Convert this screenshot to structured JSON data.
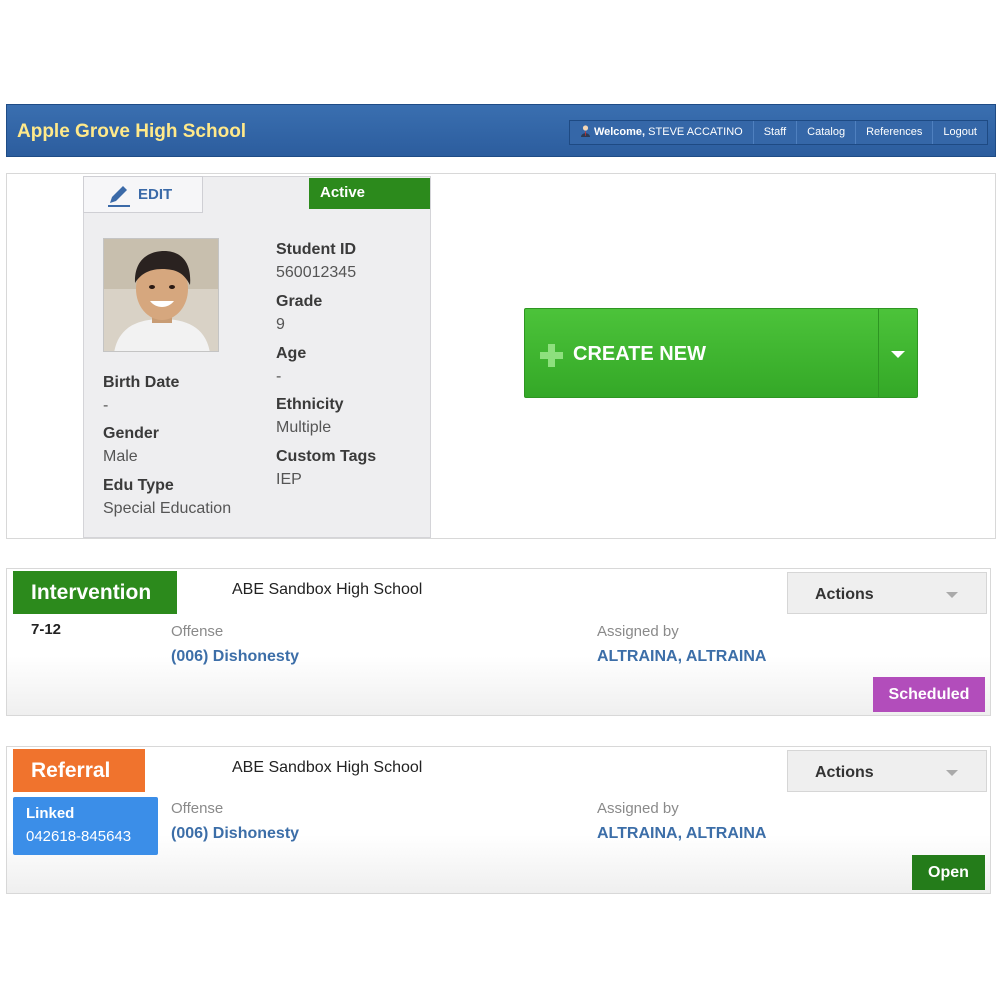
{
  "header": {
    "school_name": "Apple Grove High School",
    "welcome_prefix": "Welcome,",
    "user_name": "STEVE ACCATINO",
    "nav": [
      "Staff",
      "Catalog",
      "References",
      "Logout"
    ]
  },
  "student": {
    "edit_label": "EDIT",
    "status": "Active",
    "fields": {
      "student_id": {
        "label": "Student ID",
        "value": "560012345"
      },
      "grade": {
        "label": "Grade",
        "value": "9"
      },
      "age": {
        "label": "Age",
        "value": "-"
      },
      "ethnicity": {
        "label": "Ethnicity",
        "value": "Multiple"
      },
      "custom_tags": {
        "label": "Custom Tags",
        "value": "IEP"
      },
      "birth_date": {
        "label": "Birth Date",
        "value": "-"
      },
      "gender": {
        "label": "Gender",
        "value": "Male"
      },
      "edu_type": {
        "label": "Edu Type",
        "value": "Special Education"
      }
    }
  },
  "create_new": {
    "label": "CREATE NEW"
  },
  "records": [
    {
      "type": "Intervention",
      "school": "ABE Sandbox High School",
      "actions_label": "Actions",
      "grade_range": "7-12",
      "offense_label": "Offense",
      "offense": "(006) Dishonesty",
      "assigned_label": "Assigned by",
      "assigned_by": "ALTRAINA, ALTRAINA",
      "status": "Scheduled"
    },
    {
      "type": "Referral",
      "school": "ABE Sandbox High School",
      "actions_label": "Actions",
      "linked_label": "Linked",
      "linked_id": "042618-845643",
      "offense_label": "Offense",
      "offense": "(006) Dishonesty",
      "assigned_label": "Assigned by",
      "assigned_by": "ALTRAINA, ALTRAINA",
      "status": "Open"
    }
  ],
  "colors": {
    "header_blue": "#2c5d9e",
    "school_title": "#ffe98a",
    "active_green": "#2c8a1c",
    "create_green": "#3fb530",
    "referral_orange": "#f0732d",
    "scheduled_purple": "#b24dbb",
    "linked_blue": "#3b8ee8",
    "link_blue": "#3c6ea8"
  }
}
